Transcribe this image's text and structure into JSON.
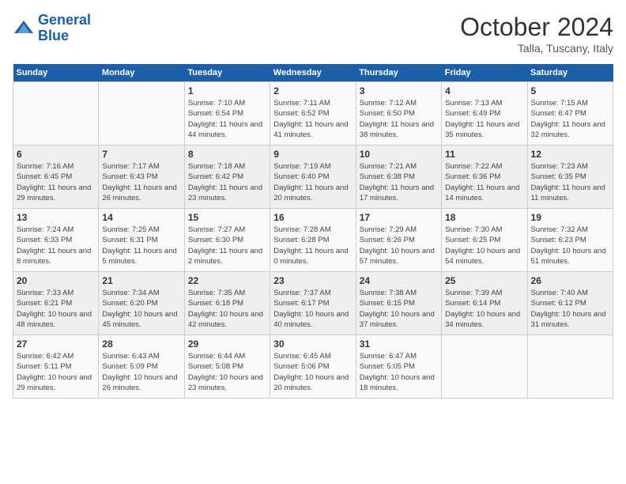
{
  "header": {
    "logo_line1": "General",
    "logo_line2": "Blue",
    "month": "October 2024",
    "location": "Talla, Tuscany, Italy"
  },
  "weekdays": [
    "Sunday",
    "Monday",
    "Tuesday",
    "Wednesday",
    "Thursday",
    "Friday",
    "Saturday"
  ],
  "weeks": [
    [
      {
        "day": "",
        "info": ""
      },
      {
        "day": "",
        "info": ""
      },
      {
        "day": "1",
        "info": "Sunrise: 7:10 AM\nSunset: 6:54 PM\nDaylight: 11 hours and 44 minutes."
      },
      {
        "day": "2",
        "info": "Sunrise: 7:11 AM\nSunset: 6:52 PM\nDaylight: 11 hours and 41 minutes."
      },
      {
        "day": "3",
        "info": "Sunrise: 7:12 AM\nSunset: 6:50 PM\nDaylight: 11 hours and 38 minutes."
      },
      {
        "day": "4",
        "info": "Sunrise: 7:13 AM\nSunset: 6:49 PM\nDaylight: 11 hours and 35 minutes."
      },
      {
        "day": "5",
        "info": "Sunrise: 7:15 AM\nSunset: 6:47 PM\nDaylight: 11 hours and 32 minutes."
      }
    ],
    [
      {
        "day": "6",
        "info": "Sunrise: 7:16 AM\nSunset: 6:45 PM\nDaylight: 11 hours and 29 minutes."
      },
      {
        "day": "7",
        "info": "Sunrise: 7:17 AM\nSunset: 6:43 PM\nDaylight: 11 hours and 26 minutes."
      },
      {
        "day": "8",
        "info": "Sunrise: 7:18 AM\nSunset: 6:42 PM\nDaylight: 11 hours and 23 minutes."
      },
      {
        "day": "9",
        "info": "Sunrise: 7:19 AM\nSunset: 6:40 PM\nDaylight: 11 hours and 20 minutes."
      },
      {
        "day": "10",
        "info": "Sunrise: 7:21 AM\nSunset: 6:38 PM\nDaylight: 11 hours and 17 minutes."
      },
      {
        "day": "11",
        "info": "Sunrise: 7:22 AM\nSunset: 6:36 PM\nDaylight: 11 hours and 14 minutes."
      },
      {
        "day": "12",
        "info": "Sunrise: 7:23 AM\nSunset: 6:35 PM\nDaylight: 11 hours and 11 minutes."
      }
    ],
    [
      {
        "day": "13",
        "info": "Sunrise: 7:24 AM\nSunset: 6:33 PM\nDaylight: 11 hours and 8 minutes."
      },
      {
        "day": "14",
        "info": "Sunrise: 7:25 AM\nSunset: 6:31 PM\nDaylight: 11 hours and 5 minutes."
      },
      {
        "day": "15",
        "info": "Sunrise: 7:27 AM\nSunset: 6:30 PM\nDaylight: 11 hours and 2 minutes."
      },
      {
        "day": "16",
        "info": "Sunrise: 7:28 AM\nSunset: 6:28 PM\nDaylight: 11 hours and 0 minutes."
      },
      {
        "day": "17",
        "info": "Sunrise: 7:29 AM\nSunset: 6:26 PM\nDaylight: 10 hours and 57 minutes."
      },
      {
        "day": "18",
        "info": "Sunrise: 7:30 AM\nSunset: 6:25 PM\nDaylight: 10 hours and 54 minutes."
      },
      {
        "day": "19",
        "info": "Sunrise: 7:32 AM\nSunset: 6:23 PM\nDaylight: 10 hours and 51 minutes."
      }
    ],
    [
      {
        "day": "20",
        "info": "Sunrise: 7:33 AM\nSunset: 6:21 PM\nDaylight: 10 hours and 48 minutes."
      },
      {
        "day": "21",
        "info": "Sunrise: 7:34 AM\nSunset: 6:20 PM\nDaylight: 10 hours and 45 minutes."
      },
      {
        "day": "22",
        "info": "Sunrise: 7:35 AM\nSunset: 6:18 PM\nDaylight: 10 hours and 42 minutes."
      },
      {
        "day": "23",
        "info": "Sunrise: 7:37 AM\nSunset: 6:17 PM\nDaylight: 10 hours and 40 minutes."
      },
      {
        "day": "24",
        "info": "Sunrise: 7:38 AM\nSunset: 6:15 PM\nDaylight: 10 hours and 37 minutes."
      },
      {
        "day": "25",
        "info": "Sunrise: 7:39 AM\nSunset: 6:14 PM\nDaylight: 10 hours and 34 minutes."
      },
      {
        "day": "26",
        "info": "Sunrise: 7:40 AM\nSunset: 6:12 PM\nDaylight: 10 hours and 31 minutes."
      }
    ],
    [
      {
        "day": "27",
        "info": "Sunrise: 6:42 AM\nSunset: 5:11 PM\nDaylight: 10 hours and 29 minutes."
      },
      {
        "day": "28",
        "info": "Sunrise: 6:43 AM\nSunset: 5:09 PM\nDaylight: 10 hours and 26 minutes."
      },
      {
        "day": "29",
        "info": "Sunrise: 6:44 AM\nSunset: 5:08 PM\nDaylight: 10 hours and 23 minutes."
      },
      {
        "day": "30",
        "info": "Sunrise: 6:45 AM\nSunset: 5:06 PM\nDaylight: 10 hours and 20 minutes."
      },
      {
        "day": "31",
        "info": "Sunrise: 6:47 AM\nSunset: 5:05 PM\nDaylight: 10 hours and 18 minutes."
      },
      {
        "day": "",
        "info": ""
      },
      {
        "day": "",
        "info": ""
      }
    ]
  ]
}
